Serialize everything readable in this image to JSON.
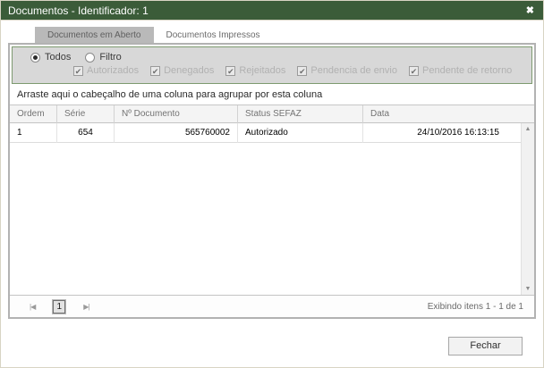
{
  "window": {
    "title": "Documentos - Identificador: 1",
    "close_icon": "✖"
  },
  "tabs": [
    {
      "label": "Documentos em Aberto",
      "active": true
    },
    {
      "label": "Documentos Impressos",
      "active": false
    }
  ],
  "filter": {
    "radio_todos": "Todos",
    "radio_filtro": "Filtro",
    "selected_radio": "Todos",
    "check_glyph": "✔",
    "checkboxes": [
      {
        "label": "Autorizados",
        "checked": true,
        "disabled": true
      },
      {
        "label": "Denegados",
        "checked": true,
        "disabled": true
      },
      {
        "label": "Rejeitados",
        "checked": true,
        "disabled": true
      },
      {
        "label": "Pendencia de envio",
        "checked": true,
        "disabled": true
      },
      {
        "label": "Pendente de retorno",
        "checked": true,
        "disabled": true
      }
    ]
  },
  "group_hint": "Arraste aqui o cabeçalho de uma coluna para agrupar por esta coluna",
  "grid": {
    "columns": [
      "Ordem",
      "Série",
      "Nº Documento",
      "Status SEFAZ",
      "Data"
    ],
    "rows": [
      [
        "1",
        "654",
        "565760002",
        "Autorizado",
        "24/10/2016 16:13:15"
      ]
    ]
  },
  "scrollbar": {
    "up_icon": "▲",
    "down_icon": "▼"
  },
  "pager": {
    "first_icon": "|◀",
    "last_icon": "▶|",
    "current_page": "1",
    "status": "Exibindo itens 1 - 1 de 1"
  },
  "footer": {
    "close_button": "Fechar"
  },
  "colors": {
    "titlebar_green": "#3b5c39",
    "filter_border_green": "#7d9a6f",
    "filter_bg_gray": "#d8d8d8",
    "active_tab_gray": "#b9b9b9",
    "frame_border_gray": "#b2b2b2"
  }
}
